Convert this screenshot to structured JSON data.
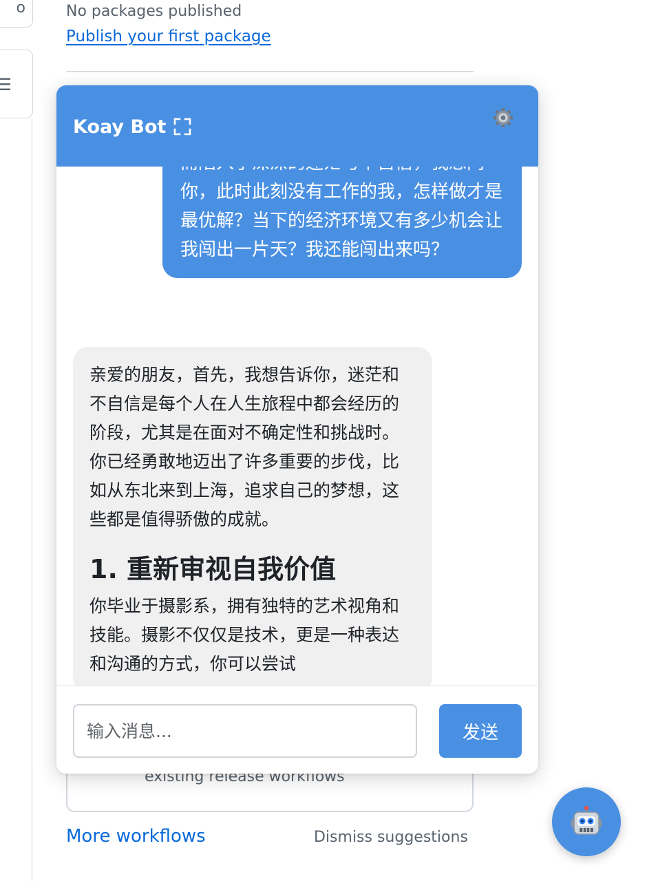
{
  "background": {
    "packages": {
      "empty_text": "No packages published",
      "publish_link": "Publish your first package"
    },
    "workflows": {
      "card_description": "existing release workflows",
      "more_link": "More workflows",
      "dismiss_link": "Dismiss suggestions"
    }
  },
  "chat": {
    "title": "Koay Bot",
    "header_color": "#4a90e2",
    "icons": {
      "expand": "expand-icon",
      "settings": "gear-icon",
      "launcher": "robot-icon"
    },
    "messages": [
      {
        "role": "user",
        "text": "业，现在找工作万千烦，我已失业了，从而陷入了深深的迷茫与不自信，我想问你，此时此刻没有工作的我，怎样做才是最优解？当下的经济环境又有多少机会让我闯出一片天？我还能闯出来吗？"
      },
      {
        "role": "bot",
        "intro": "亲爱的朋友，首先，我想告诉你，迷茫和不自信是每个人在人生旅程中都会经历的阶段，尤其是在面对不确定性和挑战时。你已经勇敢地迈出了许多重要的步伐，比如从东北来到上海，追求自己的梦想，这些都是值得骄傲的成就。",
        "heading": "1. 重新审视自我价值",
        "body": "你毕业于摄影系，拥有独特的艺术视角和技能。摄影不仅仅是技术，更是一种表达和沟通的方式，你可以尝试"
      }
    ],
    "input": {
      "placeholder": "输入消息...",
      "value": ""
    },
    "send_label": "发送"
  }
}
